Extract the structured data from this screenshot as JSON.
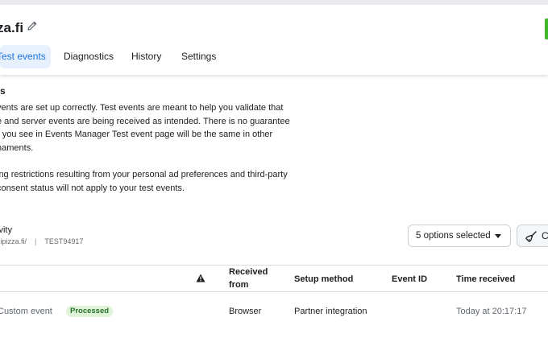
{
  "header": {
    "title": "za.fi",
    "tabs": [
      {
        "label": "Test events",
        "active": true
      },
      {
        "label": "Diagnostics"
      },
      {
        "label": "History"
      },
      {
        "label": "Settings"
      }
    ]
  },
  "section": {
    "title": "ts",
    "paragraph1": "vents are set up correctly. Test events are meant to help you validate that\ne and server events are being received as intended. There is no guarantee\nr you see in Events Manager Test event page will be the same in other\nnaments.",
    "paragraph2": "ing restrictions resulting from your personal ad preferences and third-party\n consent status will not apply to your test events."
  },
  "activity": {
    "title": "ivity",
    "url": "izipizza.fi/",
    "separator": "|",
    "test_code": "TEST94917",
    "filter_value": "5 options selected",
    "clear_label": "C"
  },
  "table": {
    "headers": {
      "received_from": "Received\nfrom",
      "setup_method": "Setup method",
      "event_id": "Event ID",
      "time_received": "Time received"
    },
    "rows": [
      {
        "event": "Custom event",
        "status": "Processed",
        "received_from": "Browser",
        "setup_method": "Partner integration",
        "event_id": "",
        "time_received": "Today at 20:17:17"
      }
    ]
  },
  "colors": {
    "accent": "#1b74e4",
    "active_tab_bg": "#e7f0fd",
    "status_green_bg": "#dff3d8",
    "status_green_text": "#28702a",
    "right_edge_green": "#42b72a"
  },
  "icons": [
    "pencil-icon",
    "warning-icon",
    "caret-down-icon",
    "broom-icon"
  ]
}
